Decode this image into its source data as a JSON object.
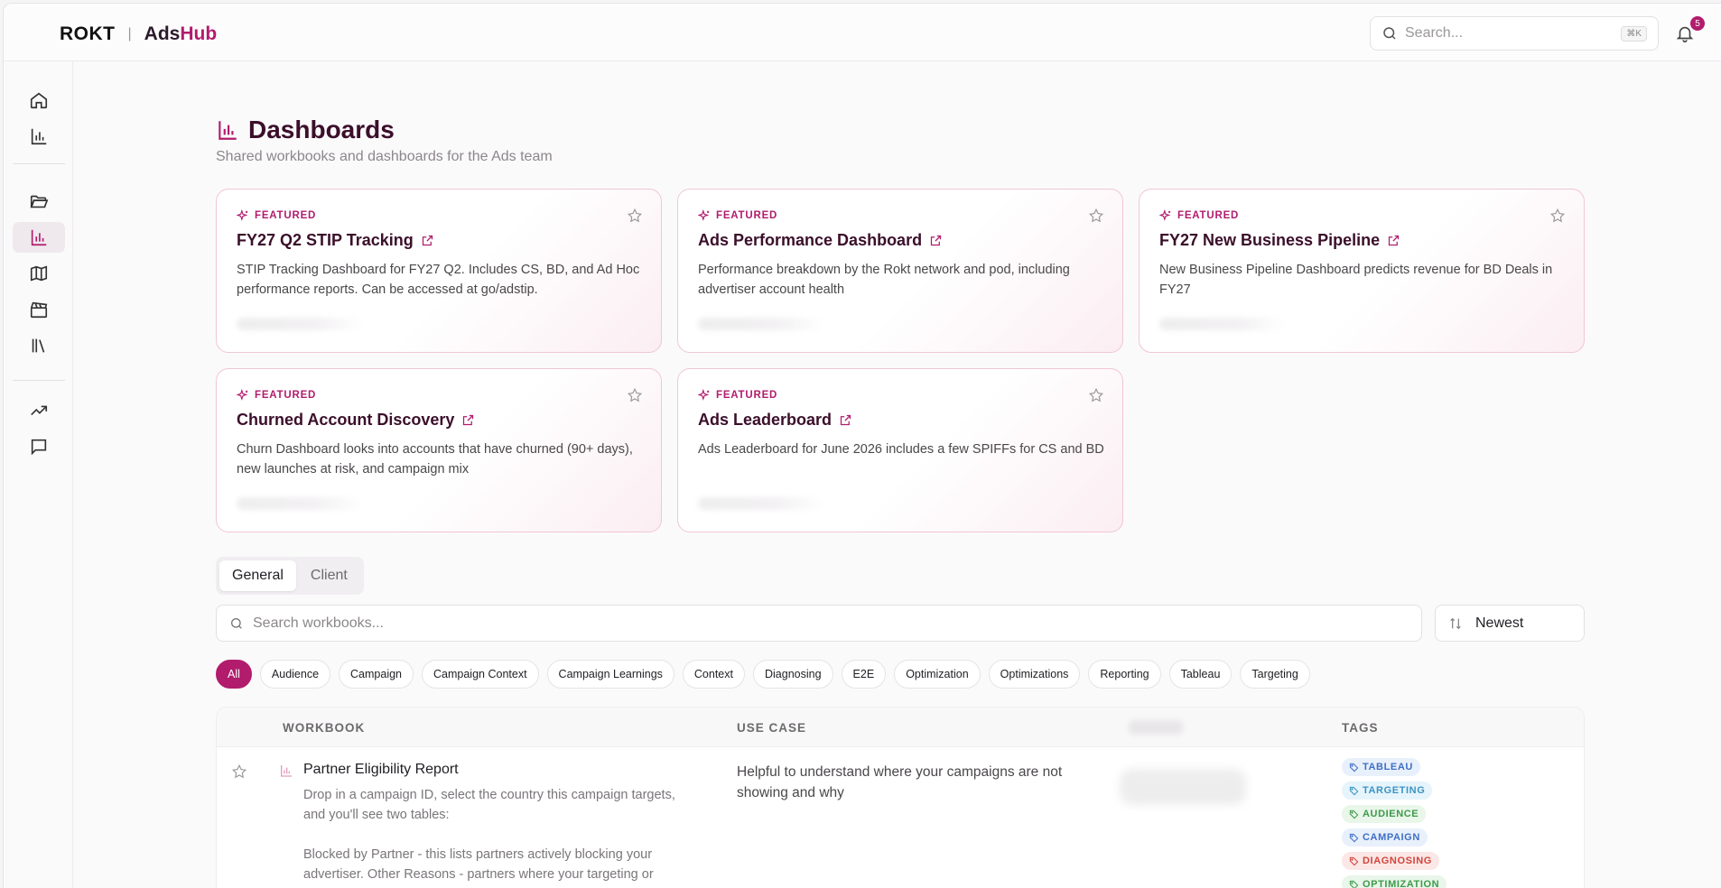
{
  "brand": {
    "rokt": "ROKT",
    "separator": "|",
    "app_prefix": "Ads",
    "app_suffix": "Hub"
  },
  "search": {
    "placeholder": "Search...",
    "shortcut": "⌘K"
  },
  "notifications": {
    "count": "5"
  },
  "page": {
    "title": "Dashboards",
    "subtitle": "Shared workbooks and dashboards for the Ads team"
  },
  "featured_label": "FEATURED",
  "cards": [
    {
      "title": "FY27 Q2 STIP Tracking",
      "desc": "STIP Tracking Dashboard for FY27 Q2. Includes CS, BD, and Ad Hoc performance reports. Can be accessed at go/adstip."
    },
    {
      "title": "Ads Performance Dashboard",
      "desc": "Performance breakdown by the Rokt network and pod, including advertiser account health"
    },
    {
      "title": "FY27 New Business Pipeline",
      "desc": "New Business Pipeline Dashboard predicts revenue for BD Deals in FY27"
    },
    {
      "title": "Churned Account Discovery",
      "desc": "Churn Dashboard looks into accounts that have churned (90+ days), new launches at risk, and campaign mix"
    },
    {
      "title": "Ads Leaderboard",
      "desc": "Ads Leaderboard for June 2026 includes a few SPIFFs for CS and BD"
    }
  ],
  "tabs": [
    {
      "label": "General"
    },
    {
      "label": "Client"
    }
  ],
  "workbook_search": {
    "placeholder": "Search workbooks..."
  },
  "sort": {
    "label": "Newest"
  },
  "filters": [
    "All",
    "Audience",
    "Campaign",
    "Campaign Context",
    "Campaign Learnings",
    "Context",
    "Diagnosing",
    "E2E",
    "Optimization",
    "Optimizations",
    "Reporting",
    "Tableau",
    "Targeting"
  ],
  "table": {
    "columns": {
      "workbook": "WORKBOOK",
      "use_case": "USE CASE",
      "tags": "TAGS"
    },
    "rows": [
      {
        "name": "Partner Eligibility Report",
        "desc": "Drop in a campaign ID, select the country this campaign targets, and you'll see two tables:\n\nBlocked by Partner - this lists partners actively blocking your advertiser. Other Reasons - partners where your targeting or creatives are preventing you from showing",
        "use_case": "Helpful to understand where your campaigns are not showing and why",
        "tags": [
          "TABLEAU",
          "TARGETING",
          "AUDIENCE",
          "CAMPAIGN",
          "DIAGNOSING",
          "OPTIMIZATION"
        ]
      }
    ]
  },
  "colors": {
    "accent": "#b11c6d",
    "title": "#3b0f2a"
  }
}
